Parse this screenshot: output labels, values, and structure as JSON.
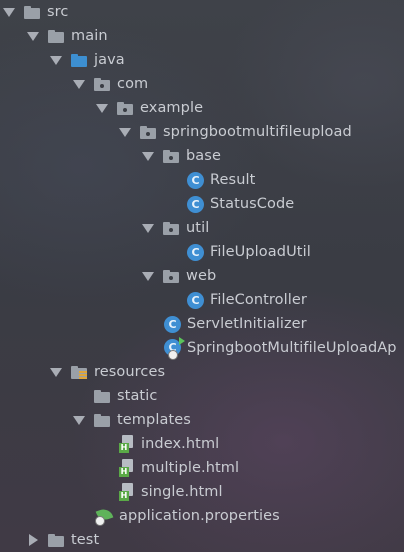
{
  "tree": [
    {
      "label": "src",
      "arrow": "down",
      "icon": "folder"
    },
    {
      "label": "main",
      "arrow": "down",
      "icon": "folder"
    },
    {
      "label": "java",
      "arrow": "down",
      "icon": "folder-blue"
    },
    {
      "label": "com",
      "arrow": "down",
      "icon": "package"
    },
    {
      "label": "example",
      "arrow": "down",
      "icon": "package"
    },
    {
      "label": "springbootmultifileupload",
      "arrow": "down",
      "icon": "package"
    },
    {
      "label": "base",
      "arrow": "down",
      "icon": "package"
    },
    {
      "label": "Result",
      "arrow": "none",
      "icon": "class"
    },
    {
      "label": "StatusCode",
      "arrow": "none",
      "icon": "class"
    },
    {
      "label": "util",
      "arrow": "down",
      "icon": "package"
    },
    {
      "label": "FileUploadUtil",
      "arrow": "none",
      "icon": "class"
    },
    {
      "label": "web",
      "arrow": "down",
      "icon": "package"
    },
    {
      "label": "FileController",
      "arrow": "none",
      "icon": "class"
    },
    {
      "label": "ServletInitializer",
      "arrow": "none",
      "icon": "class"
    },
    {
      "label": "SpringbootMultifileUploadAp",
      "arrow": "none",
      "icon": "spring-app"
    },
    {
      "label": "resources",
      "arrow": "down",
      "icon": "resources-folder"
    },
    {
      "label": "static",
      "arrow": "none",
      "icon": "folder"
    },
    {
      "label": "templates",
      "arrow": "down",
      "icon": "folder"
    },
    {
      "label": "index.html",
      "arrow": "none",
      "icon": "html-file"
    },
    {
      "label": "multiple.html",
      "arrow": "none",
      "icon": "html-file"
    },
    {
      "label": "single.html",
      "arrow": "none",
      "icon": "html-file"
    },
    {
      "label": "application.properties",
      "arrow": "none",
      "icon": "spring-properties"
    },
    {
      "label": "test",
      "arrow": "right",
      "icon": "folder"
    }
  ],
  "icons": {
    "class_letter": "C",
    "html_letter": "H"
  },
  "colors": {
    "folder": "#9aa0a8",
    "source_folder": "#3d8fd1",
    "class_icon": "#3f8fd3",
    "html_badge": "#5aa947",
    "spring_leaf": "#5fb35a",
    "text": "#c9ccd2"
  }
}
